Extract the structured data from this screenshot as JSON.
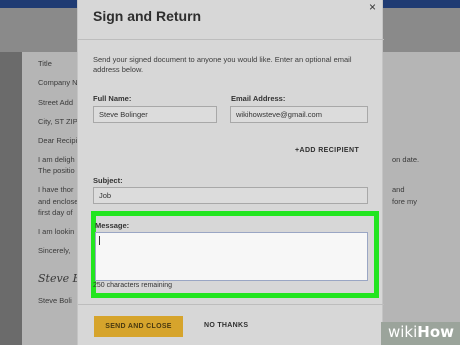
{
  "background_document": {
    "lines": [
      "Title",
      "Company N",
      "Street Add",
      "City, ST ZIP",
      "Dear Recipi",
      "I am deligh",
      "The positio",
      "I have thor",
      "and enclosed a",
      "first day of",
      "I am lookin",
      "Sincerely,",
      "Steve Boli"
    ],
    "signature": "Steve Bo",
    "right_fragments": [
      "on date.",
      "and",
      "fore my"
    ]
  },
  "modal": {
    "title": "Sign and Return",
    "close_symbol": "×",
    "intro": "Send your signed document to anyone you would like. Enter an optional email address below.",
    "full_name": {
      "label": "Full Name:",
      "value": "Steve Bolinger"
    },
    "email": {
      "label": "Email Address:",
      "value": "wikihowsteve@gmail.com"
    },
    "add_recipient": "+ADD RECIPIENT",
    "subject": {
      "label": "Subject:",
      "value": "Job"
    },
    "message": {
      "label": "Message:",
      "value": "",
      "remaining": "250 characters remaining"
    },
    "send_button": "SEND AND CLOSE",
    "no_thanks": "NO THANKS"
  },
  "watermark": {
    "wiki": "wiki",
    "how": "How"
  },
  "colors": {
    "highlight": "#22e51f",
    "send_button": "#d6a42c",
    "top_bar": "#1f3b73"
  }
}
